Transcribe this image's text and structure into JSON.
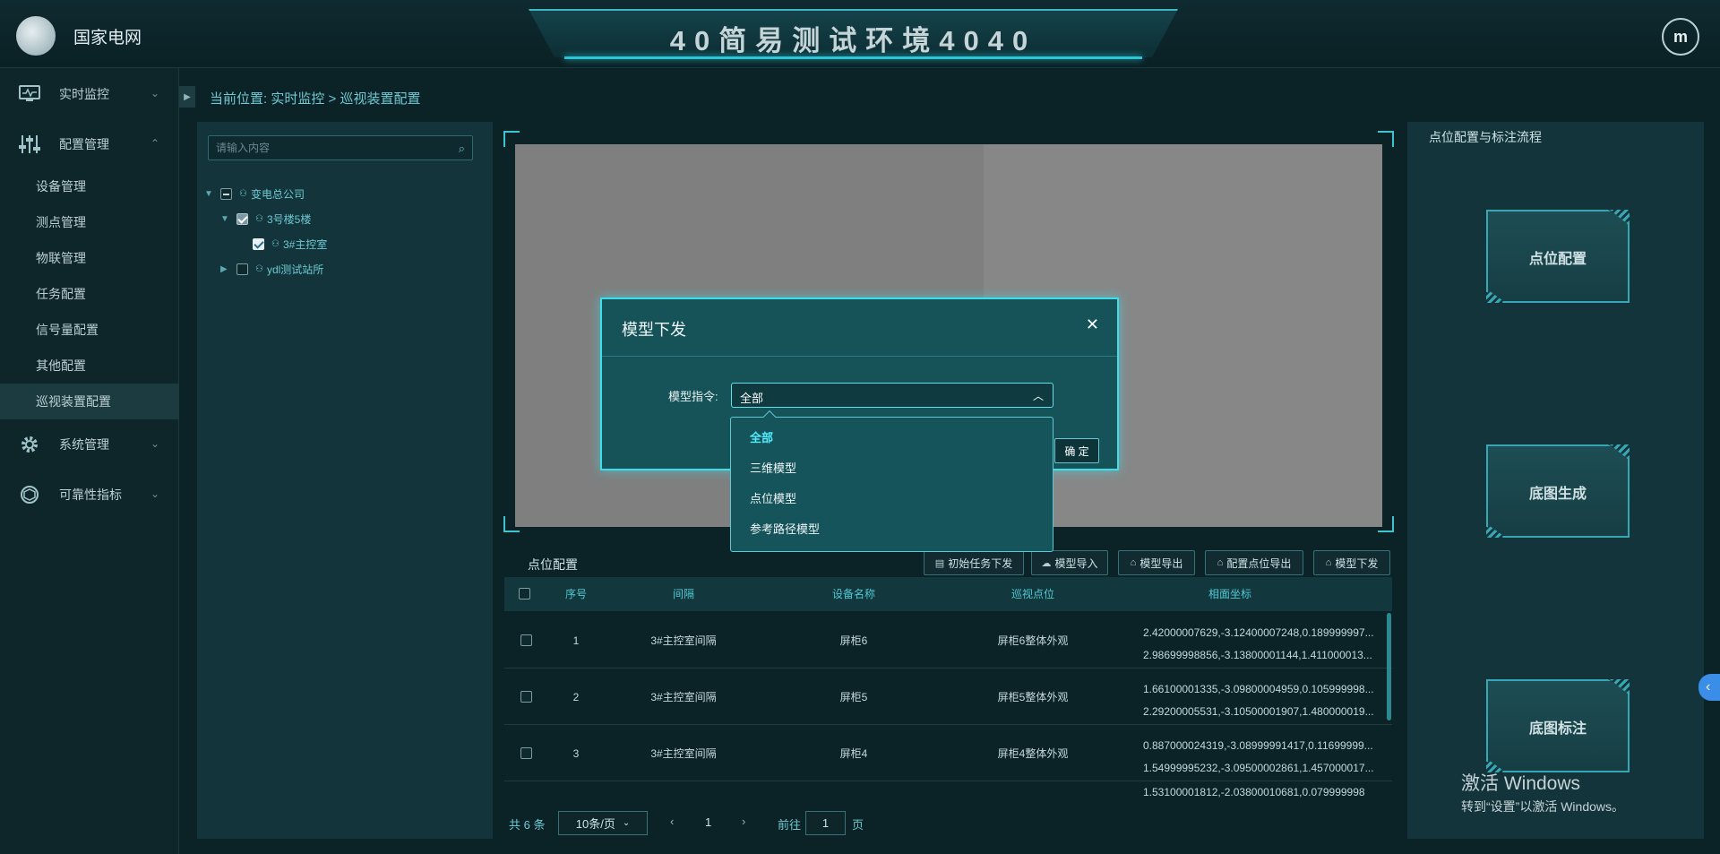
{
  "header": {
    "logo_text": "国家电网",
    "title": "40简易测试环境4040",
    "avatar_initial": "m"
  },
  "sidebar": {
    "items": [
      {
        "label": "实时监控",
        "icon": "monitor-icon"
      },
      {
        "label": "配置管理",
        "icon": "sliders-icon"
      },
      {
        "label": "系统管理",
        "icon": "gear-icon"
      },
      {
        "label": "可靠性指标",
        "icon": "target-icon"
      }
    ],
    "subitems": [
      "设备管理",
      "测点管理",
      "物联管理",
      "任务配置",
      "信号量配置",
      "其他配置",
      "巡视装置配置"
    ]
  },
  "breadcrumb": {
    "prefix": "当前位置:",
    "path": "实时监控 > 巡视装置配置"
  },
  "tree": {
    "search_placeholder": "请输入内容",
    "nodes": [
      "变电总公司",
      "3号楼5楼",
      "3#主控室",
      "ydl测试站所"
    ]
  },
  "modal": {
    "title": "模型下发",
    "field_label": "模型指令:",
    "selected_value": "全部",
    "confirm_label": "确 定",
    "options": [
      "全部",
      "三维模型",
      "点位模型",
      "参考路径模型"
    ]
  },
  "point_config": {
    "title": "点位配置",
    "buttons": [
      "初始任务下发",
      "模型导入",
      "模型导出",
      "配置点位导出",
      "模型下发"
    ],
    "columns": [
      "序号",
      "间隔",
      "设备名称",
      "巡视点位",
      "相面坐标"
    ],
    "rows": [
      {
        "idx": "1",
        "bay": "3#主控室间隔",
        "device": "屏柜6",
        "point": "屏柜6整体外观",
        "coord1": "2.42000007629,-3.12400007248,0.189999997...",
        "coord2": "2.98699998856,-3.13800001144,1.411000013..."
      },
      {
        "idx": "2",
        "bay": "3#主控室间隔",
        "device": "屏柜5",
        "point": "屏柜5整体外观",
        "coord1": "1.66100001335,-3.09800004959,0.105999998...",
        "coord2": "2.29200005531,-3.10500001907,1.480000019..."
      },
      {
        "idx": "3",
        "bay": "3#主控室间隔",
        "device": "屏柜4",
        "point": "屏柜4整体外观",
        "coord1": "0.887000024319,-3.08999991417,0.11699999...",
        "coord2": "1.54999995232,-3.09500002861,1.457000017..."
      },
      {
        "idx": "",
        "bay": "",
        "device": "",
        "point": "",
        "coord1": "1.53100001812,-2.03800010681,0.079999998",
        "coord2": ""
      }
    ],
    "pager": {
      "total": "共 6 条",
      "size": "10条/页",
      "page": "1",
      "goto_label": "前往",
      "goto_value": "1",
      "page_unit": "页"
    }
  },
  "right_panel": {
    "title": "点位配置与标注流程",
    "steps": [
      "点位配置",
      "底图生成",
      "底图标注"
    ]
  },
  "watermark": {
    "line1": "激活 Windows",
    "line2": "转到“设置”以激活 Windows。"
  }
}
